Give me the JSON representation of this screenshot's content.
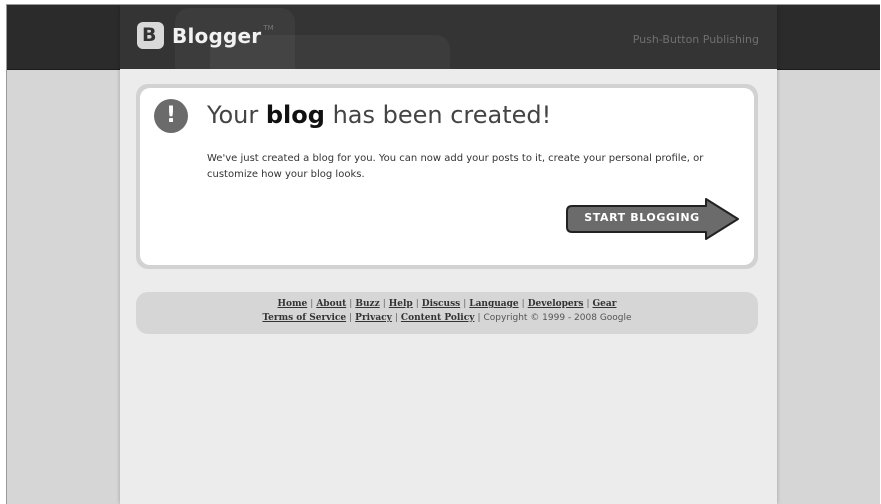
{
  "header": {
    "logo_glyph": "B",
    "logo_text": "Blogger",
    "logo_tm": "TM",
    "tagline": "Push-Button Publishing"
  },
  "notice": {
    "icon": "exclamation-icon",
    "icon_text": "!",
    "title_pre": "Your ",
    "title_bold": "blog",
    "title_post": " has been created!",
    "description": "We've just created a blog for you. You can now add your posts to it, create your personal profile, or customize how your blog looks.",
    "button_label": "START BLOGGING"
  },
  "footer": {
    "links_row1": [
      "Home",
      "About",
      "Buzz",
      "Help",
      "Discuss",
      "Language",
      "Developers",
      "Gear"
    ],
    "links_row2": [
      "Terms of Service",
      "Privacy",
      "Content Policy"
    ],
    "copyright": "Copyright © 1999 - 2008 Google"
  },
  "colors": {
    "header_bg": "#343434",
    "page_bg": "#ececec",
    "button_bg": "#6b6b6b"
  }
}
